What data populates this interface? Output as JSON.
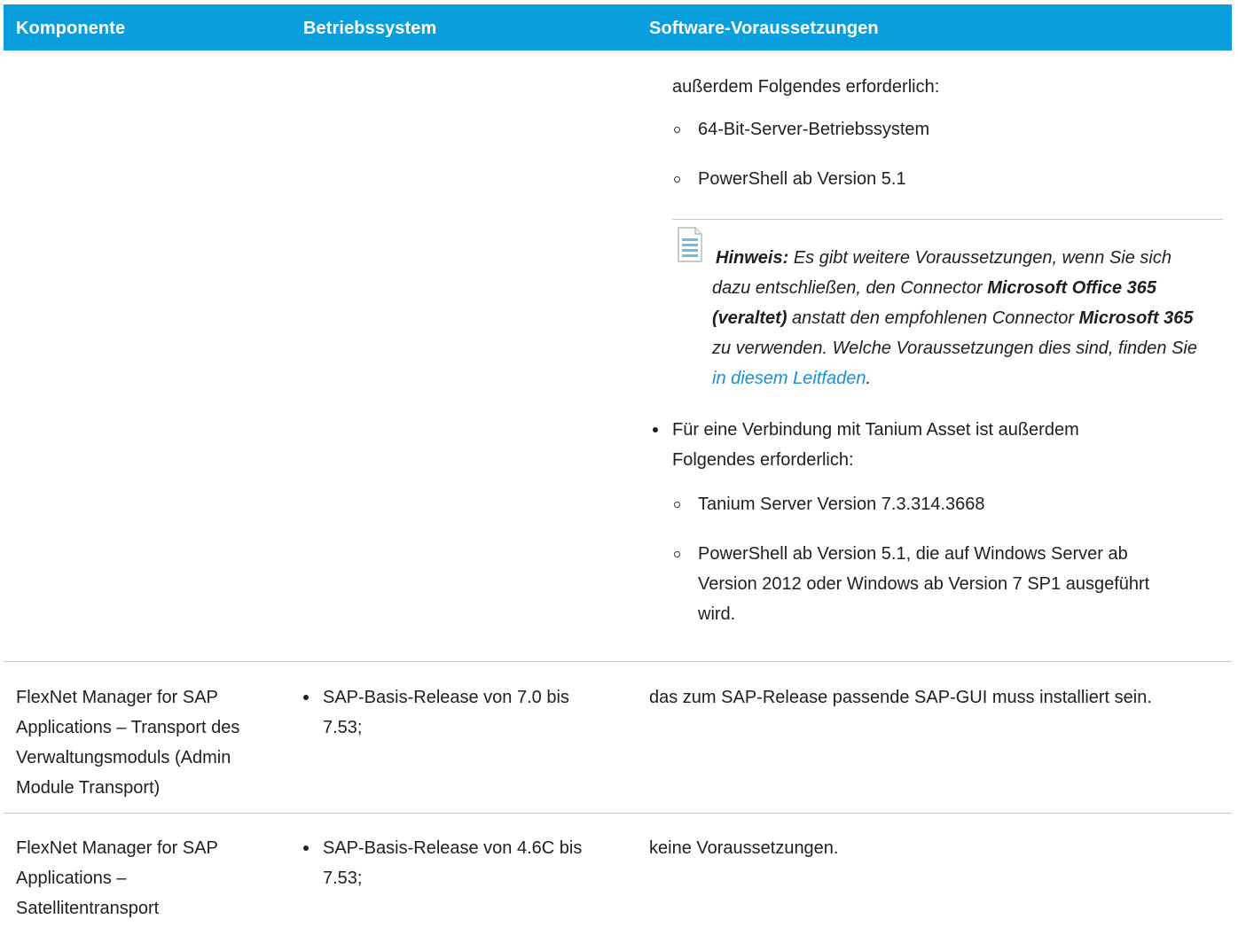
{
  "table": {
    "headers": {
      "col1": "Komponente",
      "col2": "Betriebssystem",
      "col3": "Software-Voraussetzungen"
    },
    "row0": {
      "intro": "außerdem Folgendes erforderlich:",
      "sub_items": [
        "64-Bit-Server-Betriebssystem",
        "PowerShell ab Version 5.1"
      ],
      "note": {
        "label": "Hinweis:",
        "text1": "Es gibt weitere Voraussetzungen, wenn Sie sich dazu entschließen, den Connector",
        "bold1": "Microsoft Office 365 (veraltet)",
        "text2": "anstatt den empfohlenen Connector",
        "bold2": "Microsoft 365",
        "text3": "zu verwenden. Welche Voraussetzungen dies sind, finden Sie",
        "link": "in diesem Leitfaden",
        "text4": "."
      },
      "bullet_line1": "Für eine Verbindung mit Tanium Asset ist außerdem",
      "bullet_line2": "Folgendes erforderlich:",
      "sub_items2": [
        "Tanium Server Version 7.3.314.3668",
        "PowerShell ab Version 5.1, die auf Windows Server ab",
        "Version 2012 oder Windows ab Version 7 SP1 ausgeführt",
        "wird."
      ]
    },
    "row1": {
      "component": [
        "FlexNet Manager for SAP",
        "Applications – Transport des",
        "Verwaltungsmoduls (Admin",
        "Module Transport)"
      ],
      "os": [
        "SAP-Basis-Release von 7.0 bis",
        "7.53;"
      ],
      "software": "das zum SAP-Release passende SAP-GUI muss installiert sein."
    },
    "row2": {
      "component": [
        "FlexNet Manager for SAP",
        "Applications –",
        "Satellitentransport"
      ],
      "os": [
        "SAP-Basis-Release von 4.6C bis",
        "7.53;"
      ],
      "software": "keine Voraussetzungen."
    }
  },
  "colors": {
    "header_bg": "#0a9fdc",
    "link": "#1a8fd1"
  }
}
